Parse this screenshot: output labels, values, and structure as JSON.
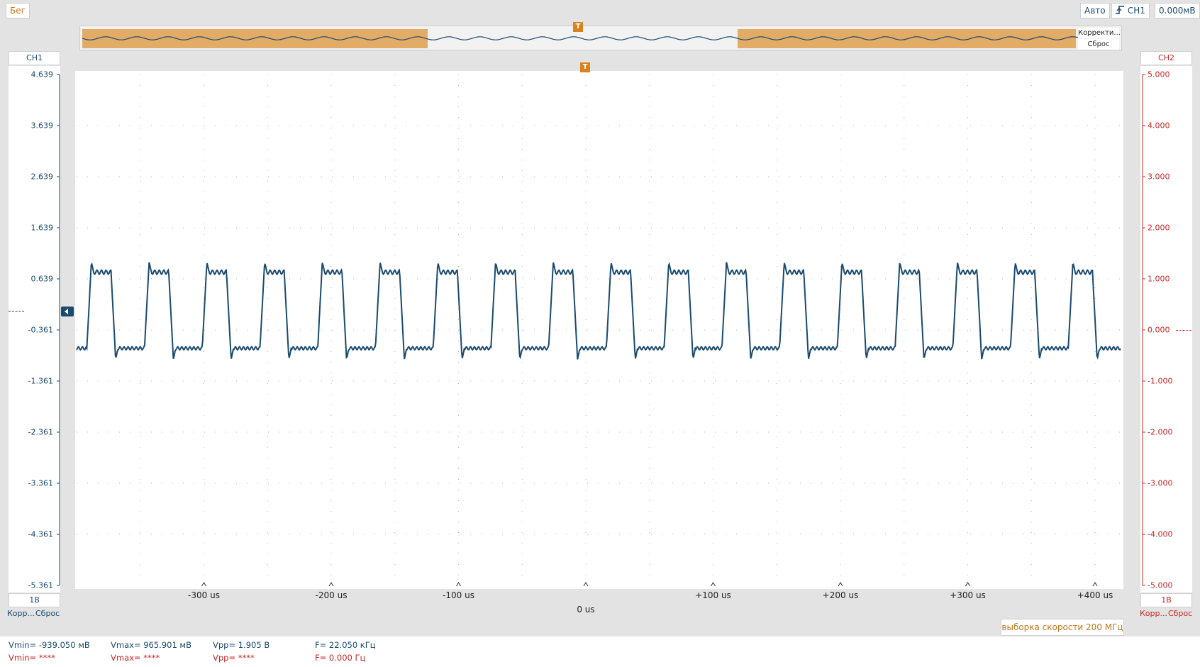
{
  "toolbar": {
    "run_label": "Бег",
    "mode_label": "Авто",
    "trigger_channel": "CH1",
    "trigger_level": "0.000мВ",
    "edge_icon": "rising-edge-icon"
  },
  "overview": {
    "correct_label": "Корректи...",
    "reset_label": "Сброс",
    "trigger_marker": "T"
  },
  "ch1": {
    "name": "CH1",
    "scale": "1В",
    "correct_label": "Корр...",
    "reset_label": "Сброс",
    "color": "#1b4a6e",
    "ticks": [
      "4.639",
      "3.639",
      "2.639",
      "1.639",
      "0.639",
      "-0.361",
      "-1.361",
      "-2.361",
      "-3.361",
      "-4.361",
      "-5.361"
    ]
  },
  "ch2": {
    "name": "CH2",
    "scale": "1В",
    "correct_label": "Корр...",
    "reset_label": "Сброс",
    "color": "#c62828",
    "ticks": [
      "5.000",
      "4.000",
      "3.000",
      "2.000",
      "1.000",
      "0.000",
      "-1.000",
      "-2.000",
      "-3.000",
      "-4.000",
      "-5.000"
    ]
  },
  "xaxis": {
    "labels": [
      "-300 us",
      "-200 us",
      "-100 us",
      "0 us",
      "+100 us",
      "+200 us",
      "+300 us",
      "+400 us"
    ]
  },
  "sample_rate": "выборка скорости 200 МГц",
  "measurements": {
    "ch1": {
      "vmin": "Vmin= -939.050 мВ",
      "vmax": "Vmax= 965.901 мВ",
      "vpp": "Vpp= 1.905 В",
      "freq": "F= 22.050 кГц"
    },
    "ch2": {
      "vmin": "Vmin= ****",
      "vmax": "Vmax= ****",
      "vpp": "Vpp= ****",
      "freq": "F= 0.000 Гц"
    }
  },
  "chart_data": {
    "type": "line",
    "xlabel": "",
    "ylabel": "",
    "xlim": [
      -400,
      420
    ],
    "ylim": [
      -5.361,
      4.639
    ],
    "frequency_khz": 22.05,
    "series": [
      {
        "name": "CH1",
        "vmin": -0.939,
        "vmax": 0.966,
        "x_unit": "us"
      }
    ]
  }
}
